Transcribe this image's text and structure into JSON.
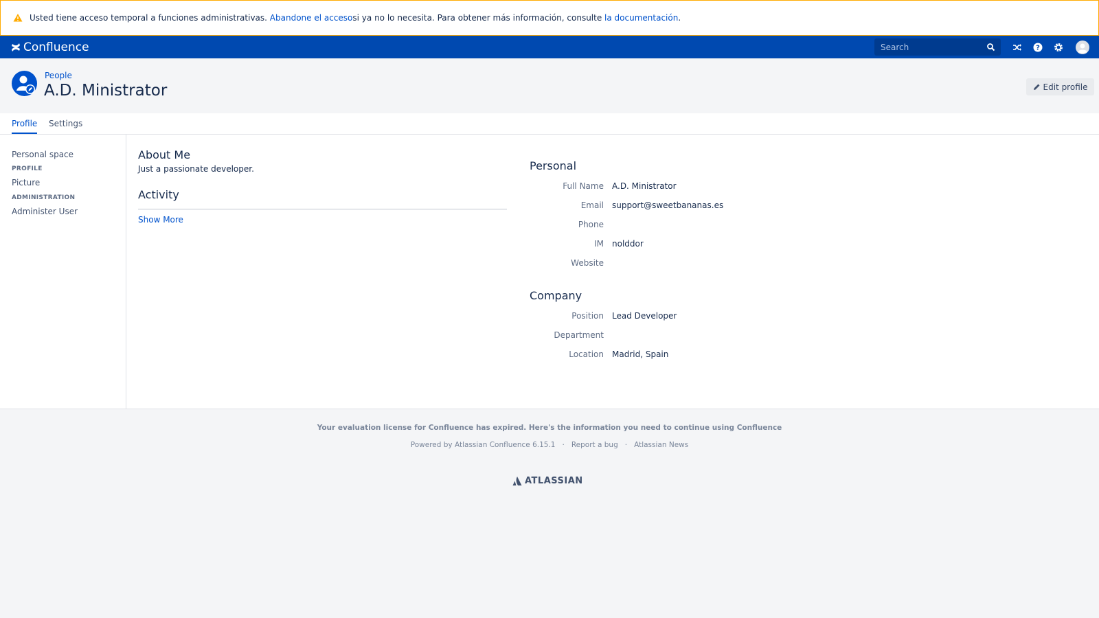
{
  "banner": {
    "text_before": "Usted tiene acceso temporal a funciones administrativas. ",
    "link_drop": "Abandone el acceso",
    "text_middle": " si ya no lo necesita. Para obtener más información, consulte ",
    "link_docs": "la documentación",
    "text_end": "."
  },
  "topnav": {
    "brand": "Confluence",
    "search_placeholder": "Search",
    "icons": [
      "search-icon",
      "shuffle-icon",
      "help-icon",
      "gear-icon",
      "user-avatar-icon"
    ]
  },
  "header": {
    "breadcrumb": "People",
    "title": "A.D. Ministrator",
    "edit_label": "Edit profile"
  },
  "tabs": [
    {
      "label": "Profile",
      "active": true
    },
    {
      "label": "Settings",
      "active": false
    }
  ],
  "sidebar": {
    "personal_space": "Personal space",
    "profile_heading": "PROFILE",
    "picture": "Picture",
    "admin_heading": "ADMINISTRATION",
    "administer_user": "Administer User"
  },
  "about": {
    "heading": "About Me",
    "text": "Just a passionate developer."
  },
  "activity": {
    "heading": "Activity",
    "show_more": "Show More"
  },
  "personal": {
    "heading": "Personal",
    "fields": [
      {
        "label": "Full Name",
        "value": "A.D. Ministrator"
      },
      {
        "label": "Email",
        "value": "support@sweetbananas.es"
      },
      {
        "label": "Phone",
        "value": ""
      },
      {
        "label": "IM",
        "value": "nolddor"
      },
      {
        "label": "Website",
        "value": ""
      }
    ]
  },
  "company": {
    "heading": "Company",
    "fields": [
      {
        "label": "Position",
        "value": "Lead Developer"
      },
      {
        "label": "Department",
        "value": ""
      },
      {
        "label": "Location",
        "value": "Madrid, Spain"
      }
    ]
  },
  "footer": {
    "license": "Your evaluation license for Confluence has expired. Here's the information you need to continue using Confluence",
    "powered": "Powered by Atlassian Confluence 6.15.1",
    "sep": "·",
    "report": "Report a bug",
    "news": "Atlassian News",
    "atlassian": "ATLASSIAN"
  },
  "colors": {
    "nav_bg": "#0049b0",
    "link": "#0052cc",
    "warning": "#ffab00"
  }
}
